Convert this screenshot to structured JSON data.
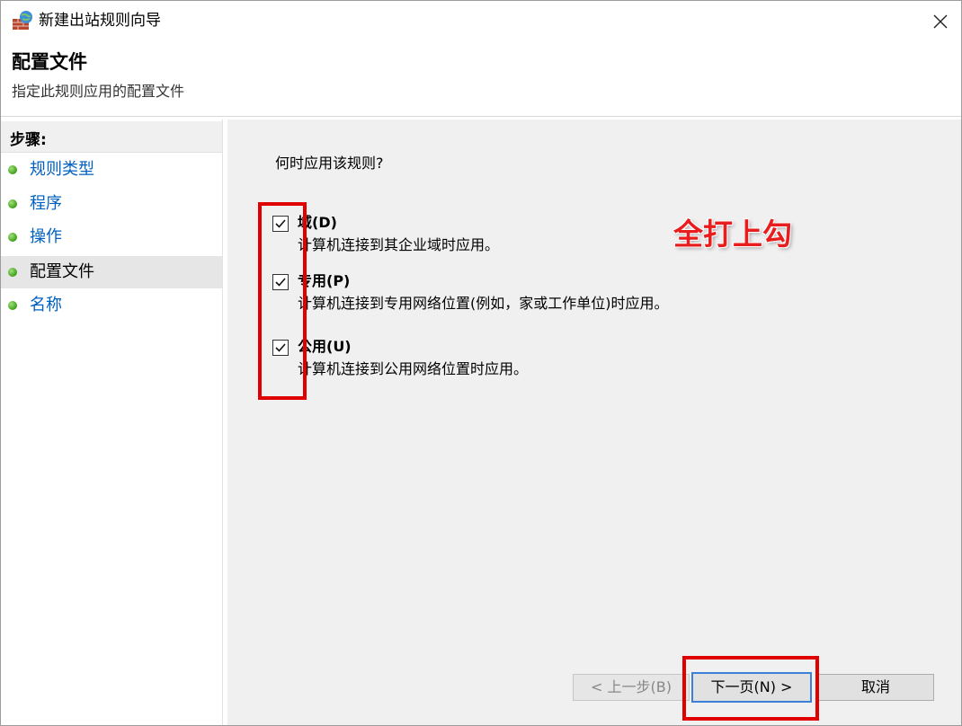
{
  "window": {
    "title": "新建出站规则向导",
    "icon": "firewall-icon"
  },
  "header": {
    "title": "配置文件",
    "subtitle": "指定此规则应用的配置文件"
  },
  "sidebar": {
    "steps_label": "步骤:",
    "items": [
      {
        "label": "规则类型",
        "active": false
      },
      {
        "label": "程序",
        "active": false
      },
      {
        "label": "操作",
        "active": false
      },
      {
        "label": "配置文件",
        "active": true
      },
      {
        "label": "名称",
        "active": false
      }
    ]
  },
  "main": {
    "question": "何时应用该规则?",
    "options": [
      {
        "title": "域(D)",
        "description": "计算机连接到其企业域时应用。",
        "checked": true
      },
      {
        "title": "专用(P)",
        "description": "计算机连接到专用网络位置(例如，家或工作单位)时应用。",
        "checked": true
      },
      {
        "title": "公用(U)",
        "description": "计算机连接到公用网络位置时应用。",
        "checked": true
      }
    ]
  },
  "buttons": {
    "back": "< 上一步(B)",
    "next": "下一页(N) >",
    "cancel": "取消"
  },
  "annotation": {
    "text": "全打上勾",
    "color": "#e81e1e"
  }
}
